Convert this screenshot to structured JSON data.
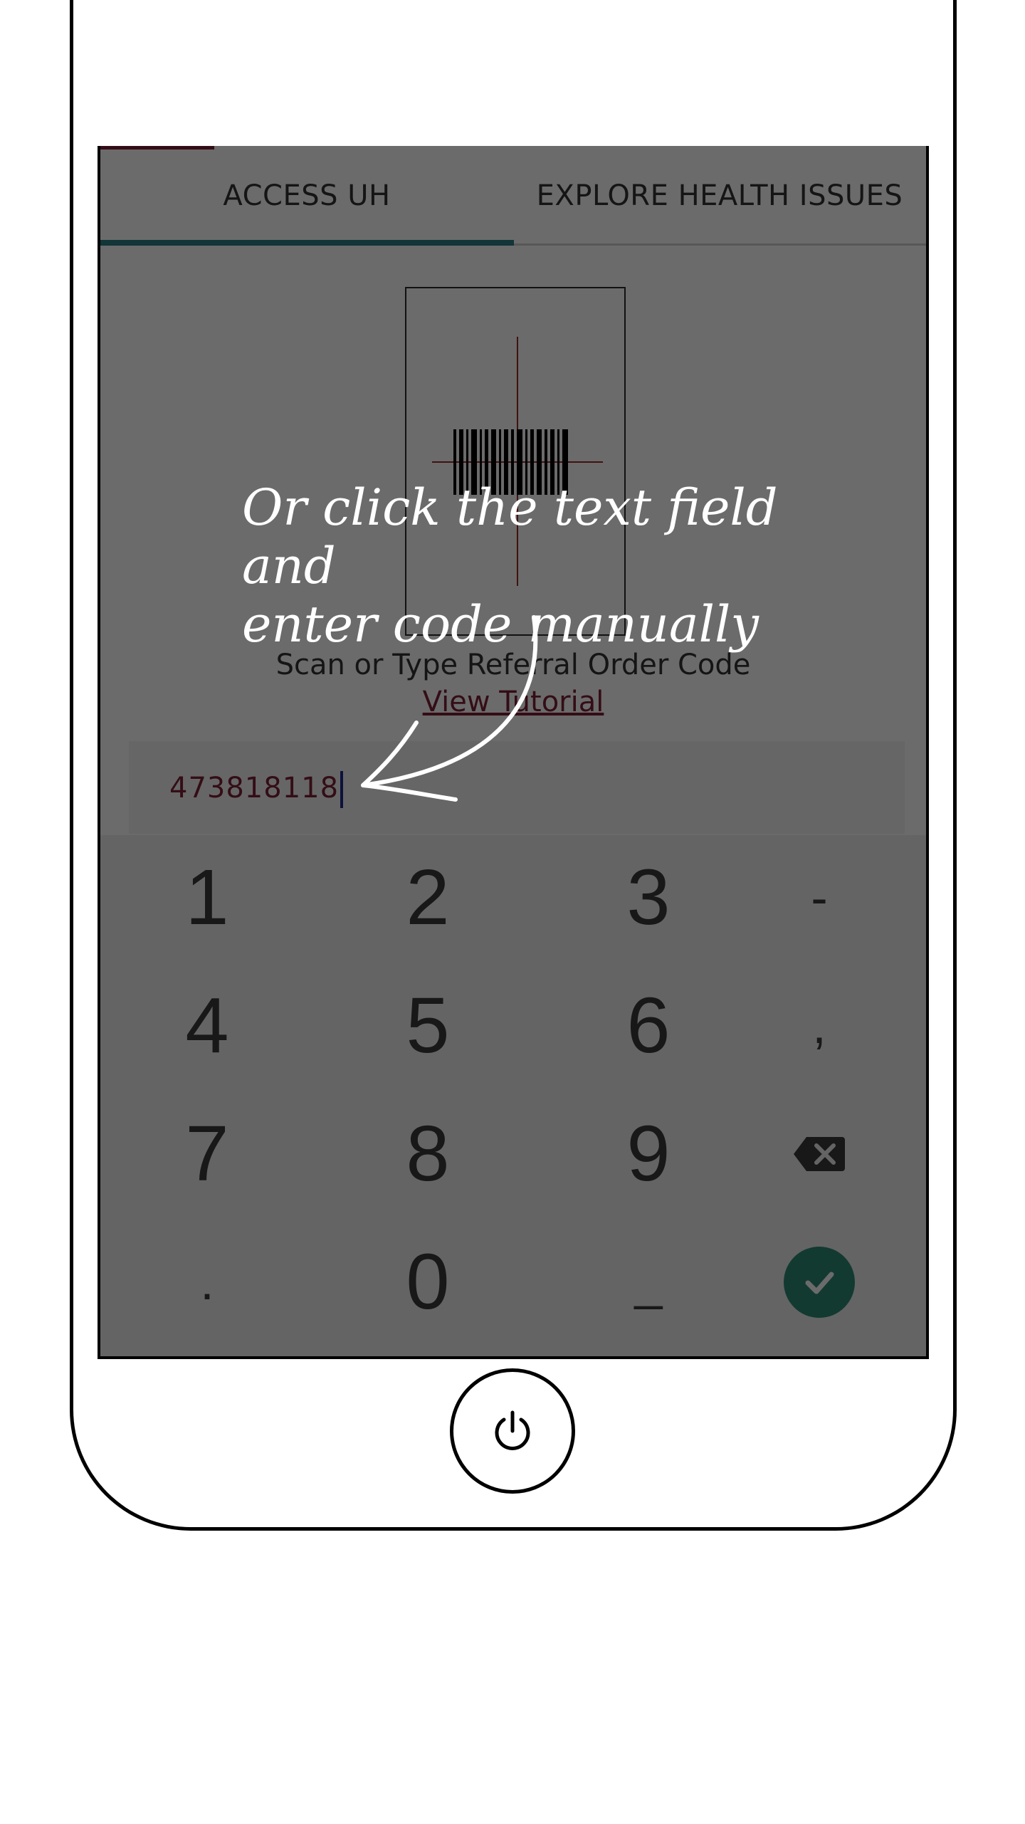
{
  "tabs": [
    {
      "label": "ACCESS UH",
      "active": true
    },
    {
      "label": "EXPLORE HEALTH ISSUES",
      "active": false
    }
  ],
  "scanner": {
    "label": "Scan or Type Referral Order Code",
    "tutorial_link": "View Tutorial"
  },
  "code_input": {
    "value": "473818118"
  },
  "keypad": {
    "row1": [
      "1",
      "2",
      "3",
      "-"
    ],
    "row2": [
      "4",
      "5",
      "6",
      ","
    ],
    "row3": [
      "7",
      "8",
      "9"
    ],
    "row4": [
      ".",
      "0",
      "_"
    ],
    "backspace_icon": "backspace-icon",
    "confirm_icon": "check-icon"
  },
  "hint": {
    "line1": "Or click the text field and",
    "line2": "enter code manually"
  },
  "colors": {
    "accent": "#7d1f36",
    "tab_indicator": "#2b7f87",
    "confirm": "#2f8a76",
    "overlay": "rgba(0,0,0,0.58)"
  },
  "home_button_icon": "power-icon"
}
